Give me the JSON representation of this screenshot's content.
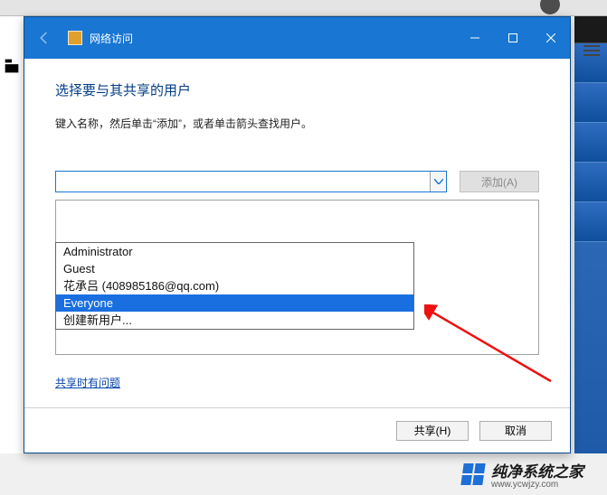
{
  "titlebar": {
    "title": "网络访问"
  },
  "main": {
    "heading": "选择要与其共享的用户",
    "subheading": "键入名称，然后单击“添加”，或者单击箭头查找用户。",
    "input_value": "",
    "input_placeholder": "",
    "add_label": "添加(A)"
  },
  "dropdown": {
    "items": [
      "Administrator",
      "Guest",
      "花承吕 (408985186@qq.com)",
      "Everyone",
      "创建新用户..."
    ],
    "selected_index": 3
  },
  "help_link": "共享时有问题",
  "footer": {
    "share_label": "共享(H)",
    "cancel_label": "取消"
  },
  "watermark": {
    "brand": "纯净系统之家",
    "url": "www.ycwjzy.com"
  }
}
